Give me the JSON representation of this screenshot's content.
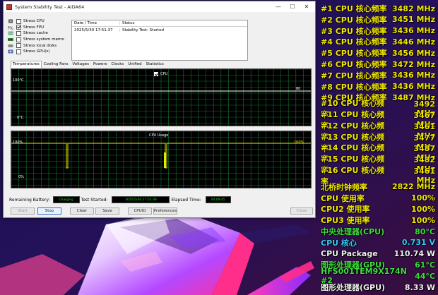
{
  "window": {
    "title": "System Stability Test - AIDA64",
    "minimize": "—",
    "maximize": "☐",
    "close": "✕"
  },
  "stress_options": [
    {
      "label": "Stress CPU",
      "checked": false,
      "device": "cpu"
    },
    {
      "label": "Stress FPU",
      "checked": true,
      "device": "fpu"
    },
    {
      "label": "Stress cache",
      "checked": false,
      "device": "cache"
    },
    {
      "label": "Stress system memo",
      "checked": false,
      "device": "memory"
    },
    {
      "label": "Stress local disks",
      "checked": false,
      "device": "disk"
    },
    {
      "label": "Stress GPU(s)",
      "checked": false,
      "device": "gpu"
    }
  ],
  "log": {
    "headers": [
      "Date / Time",
      "Status"
    ],
    "rows": [
      [
        "2025/5/30 17:51:37",
        "Stability Test: Started"
      ]
    ]
  },
  "tabs": [
    "Temperatures",
    "Cooling Fans",
    "Voltages",
    "Powers",
    "Clocks",
    "Unified",
    "Statistics"
  ],
  "active_tab": "Temperatures",
  "temp_graph": {
    "legend": "CPU",
    "y_top": "100°C",
    "y_bottom": "0°C",
    "current_value": "80",
    "line_color": "#ffffff"
  },
  "usage_graph": {
    "title": "CPU Usage",
    "y_top": "100%",
    "y_bottom": "0%",
    "current_value": "100%",
    "line_color": "#e8e800"
  },
  "status": {
    "battery_label": "Remaining Battery:",
    "battery_value": "Charging",
    "started_label": "Test Started:",
    "started_value": "2025/5/30 17:51:36",
    "elapsed_label": "Elapsed Time:",
    "elapsed_value": "00:09:45"
  },
  "buttons": {
    "start": "Start",
    "stop": "Stop",
    "clear": "Clear",
    "save": "Save",
    "cpuid": "CPUID",
    "preferences": "Preferences",
    "close": "Close"
  },
  "osd": [
    {
      "label": "#1 CPU 核心频率",
      "value": "3482 MHz",
      "color": "#f2e600"
    },
    {
      "label": "#2 CPU 核心频率",
      "value": "3451 MHz",
      "color": "#f2e600"
    },
    {
      "label": "#3 CPU 核心频率",
      "value": "3436 MHz",
      "color": "#f2e600"
    },
    {
      "label": "#4 CPU 核心频率",
      "value": "3446 MHz",
      "color": "#f2e600"
    },
    {
      "label": "#5 CPU 核心频率",
      "value": "3456 MHz",
      "color": "#f2e600"
    },
    {
      "label": "#6 CPU 核心频率",
      "value": "3472 MHz",
      "color": "#f2e600"
    },
    {
      "label": "#7 CPU 核心频率",
      "value": "3436 MHz",
      "color": "#f2e600"
    },
    {
      "label": "#8 CPU 核心频率",
      "value": "3436 MHz",
      "color": "#f2e600"
    },
    {
      "label": "#9 CPU 核心频率",
      "value": "3487 MHz",
      "color": "#f2e600"
    },
    {
      "label": "#10 CPU 核心频率",
      "value": "3492 MHz",
      "color": "#f2e600"
    },
    {
      "label": "#11 CPU 核心频率",
      "value": "3467 MHz",
      "color": "#f2e600"
    },
    {
      "label": "#12 CPU 核心频率",
      "value": "3461 MHz",
      "color": "#f2e600"
    },
    {
      "label": "#13 CPU 核心频率",
      "value": "3477 MHz",
      "color": "#f2e600"
    },
    {
      "label": "#14 CPU 核心频率",
      "value": "3487 MHz",
      "color": "#f2e600"
    },
    {
      "label": "#15 CPU 核心频率",
      "value": "3482 MHz",
      "color": "#f2e600"
    },
    {
      "label": "#16 CPU 核心频率",
      "value": "3461 MHz",
      "color": "#f2e600"
    },
    {
      "label": "北桥时钟频率",
      "value": "2822 MHz",
      "color": "#f2e600"
    },
    {
      "label": "CPU 使用率",
      "value": "100%",
      "color": "#f2e600"
    },
    {
      "label": "CPU2 使用率",
      "value": "100%",
      "color": "#f2e600"
    },
    {
      "label": "CPU3 使用率",
      "value": "100%",
      "color": "#f2e600"
    },
    {
      "label": "中央处理器(CPU)",
      "value": "80°C",
      "color": "#3fdc3f"
    },
    {
      "label": "CPU 核心",
      "value": "0.731 V",
      "color": "#37c8f5"
    },
    {
      "label": "CPU Package",
      "value": "110.74 W",
      "color": "#f0f0f0"
    },
    {
      "label": "图形处理器(GPU)",
      "value": "61°C",
      "color": "#3fdc3f"
    },
    {
      "label": "HFS001TEM9X174N #2",
      "value": "44°C",
      "color": "#3fdc3f"
    },
    {
      "label": "图形处理器(GPU)",
      "value": "8.33 W",
      "color": "#f0f0f0"
    }
  ]
}
